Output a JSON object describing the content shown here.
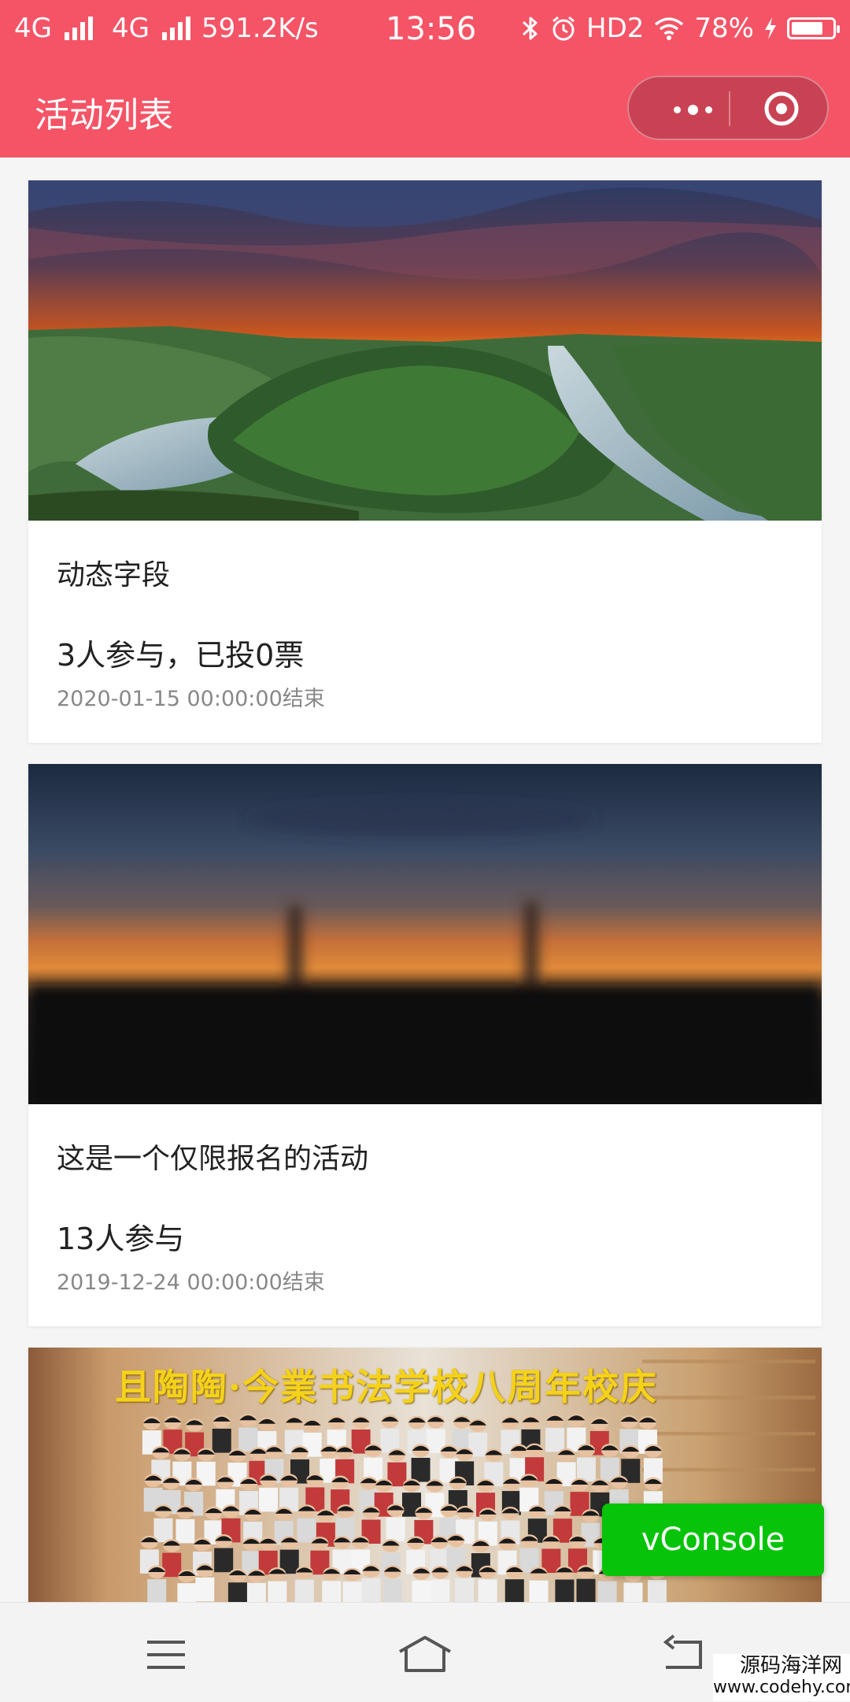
{
  "status_bar": {
    "net1": "4G",
    "net2": "4G",
    "speed": "591.2K/s",
    "time": "13:56",
    "hd": "HD2",
    "battery": "78%",
    "battery_level": 0.78
  },
  "nav": {
    "title": "活动列表"
  },
  "activities": [
    {
      "title": "动态字段",
      "stats": "3人参与，已投0票",
      "end_time": "2020-01-15 00:00:00结束"
    },
    {
      "title": "这是一个仅限报名的活动",
      "stats": "13人参与",
      "end_time": "2019-12-24 00:00:00结束"
    },
    {
      "banner_text": "且陶陶·今業书法学校八周年校庆"
    }
  ],
  "vconsole": {
    "label": "vConsole"
  },
  "watermark": {
    "line1": "源码海洋网",
    "line2": "www.codehy.com"
  },
  "colors": {
    "header": "#f45466",
    "vconsole": "#07c30a"
  }
}
